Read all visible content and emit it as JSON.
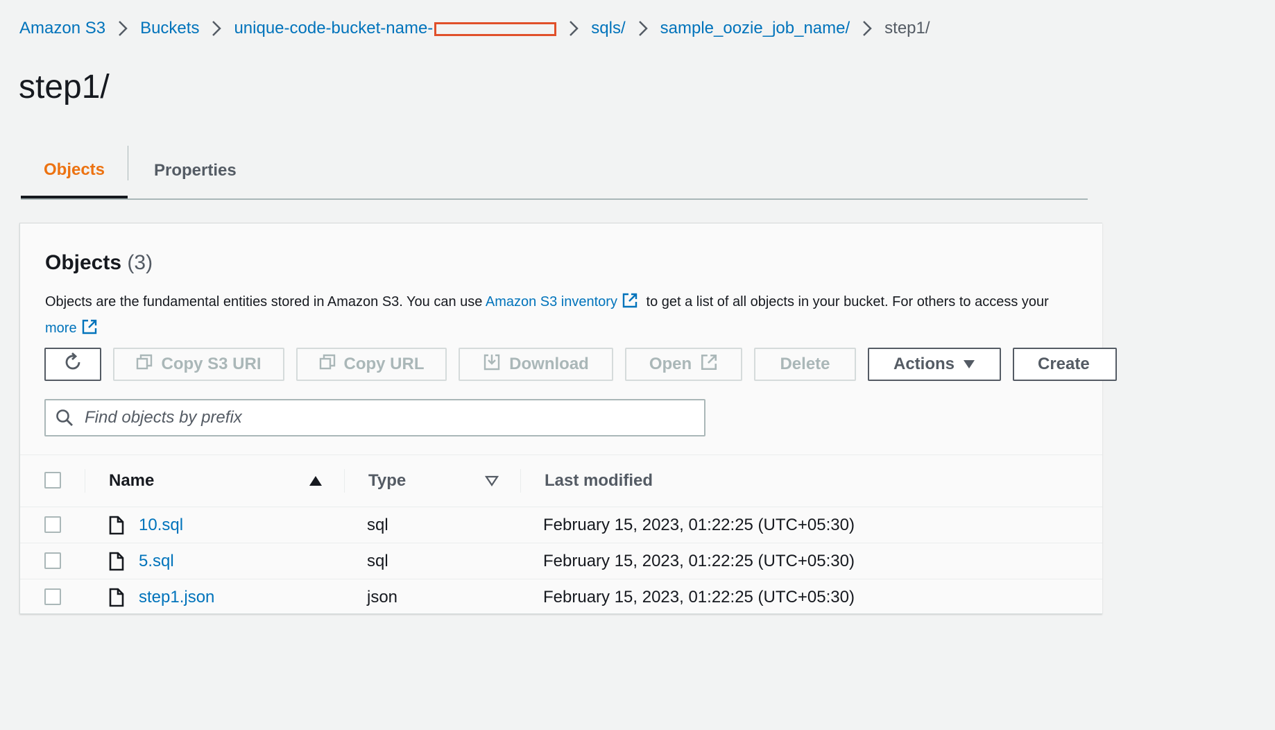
{
  "breadcrumb": {
    "items": [
      "Amazon S3",
      "Buckets",
      "unique-code-bucket-name-",
      "sqls/",
      "sample_oozie_job_name/"
    ],
    "current": "step1/"
  },
  "page": {
    "title": "step1/"
  },
  "tabs": [
    {
      "label": "Objects",
      "active": true
    },
    {
      "label": "Properties",
      "active": false
    }
  ],
  "objects_panel": {
    "heading": "Objects",
    "count": "(3)",
    "description": {
      "before": "Objects are the fundamental entities stored in Amazon S3. You can use ",
      "link1": "Amazon S3 inventory",
      "after": " to get a list of all objects in your bucket. For others to access your",
      "link2": "more"
    },
    "toolbar": {
      "copy_s3_uri": "Copy S3 URI",
      "copy_url": "Copy URL",
      "download": "Download",
      "open": "Open",
      "delete": "Delete",
      "actions": "Actions",
      "create": "Create"
    },
    "search": {
      "placeholder": "Find objects by prefix",
      "value": ""
    },
    "columns": {
      "name": "Name",
      "type": "Type",
      "last_modified": "Last modified"
    },
    "rows": [
      {
        "name": "10.sql",
        "type": "sql",
        "last_modified": "February 15, 2023, 01:22:25 (UTC+05:30)"
      },
      {
        "name": "5.sql",
        "type": "sql",
        "last_modified": "February 15, 2023, 01:22:25 (UTC+05:30)"
      },
      {
        "name": "step1.json",
        "type": "json",
        "last_modified": "February 15, 2023, 01:22:25 (UTC+05:30)"
      }
    ]
  },
  "colors": {
    "link": "#0073bb",
    "active_tab": "#ec7211",
    "redaction": "#e0502a",
    "text": "#16191f",
    "muted": "#545b64"
  },
  "icons": [
    "chevron-right-icon",
    "refresh-icon",
    "copy-icon",
    "download-icon",
    "external-link-icon",
    "caret-down-icon",
    "search-icon",
    "file-icon",
    "sort-ascending-icon",
    "sort-descending-icon"
  ]
}
